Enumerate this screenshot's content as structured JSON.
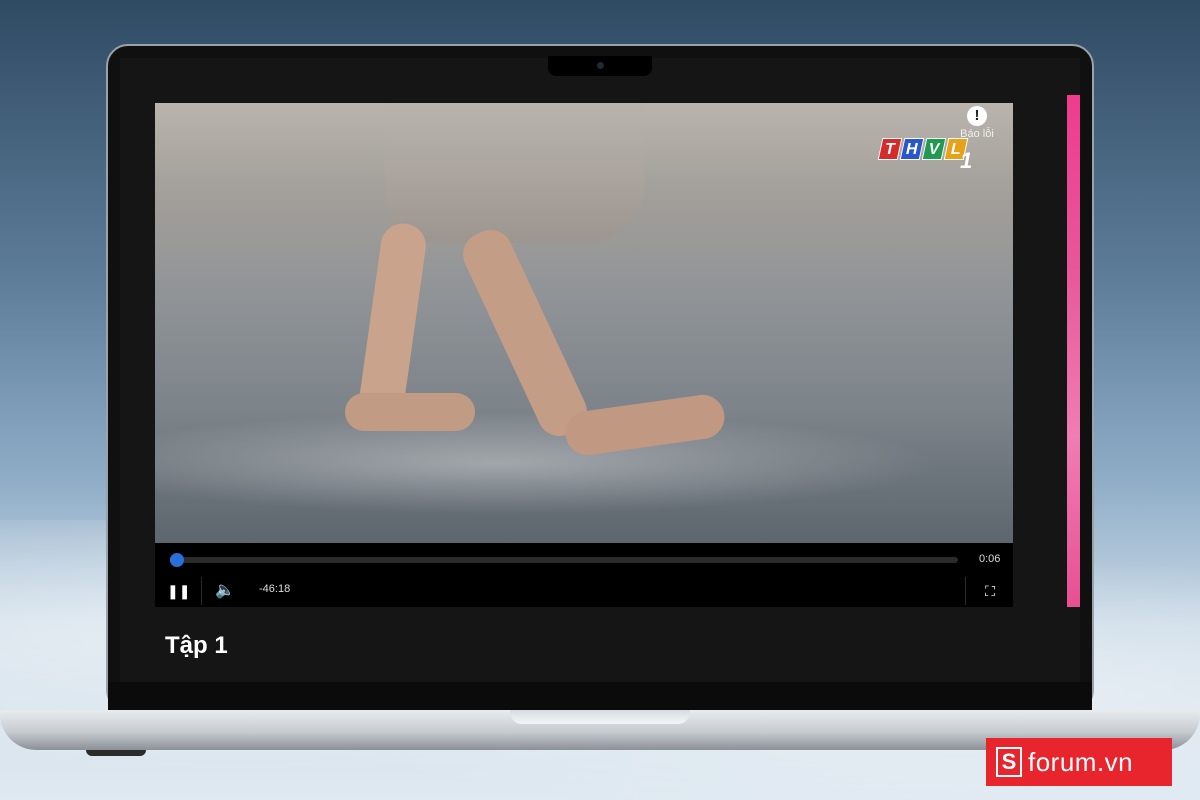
{
  "video": {
    "channel_logo_letters": [
      "T",
      "H",
      "V",
      "L"
    ],
    "channel_logo_number": "1",
    "channel_logo_colors": [
      "#d62b2b",
      "#2a57c9",
      "#1f9a4f",
      "#e7a21a"
    ],
    "report_label": "Báo lỗi"
  },
  "player": {
    "elapsed": "0:06",
    "remaining": "-46:18",
    "progress_fraction": 0.003,
    "accent_color": "#2b6fd9",
    "pause_icon": "pause-icon",
    "volume_icon": "volume-icon",
    "fullscreen_icon": "fullscreen-icon"
  },
  "episode": {
    "title": "Tập 1"
  },
  "watermark": {
    "logo_letter": "S",
    "text": "forum.vn",
    "color": "#e8242c"
  }
}
